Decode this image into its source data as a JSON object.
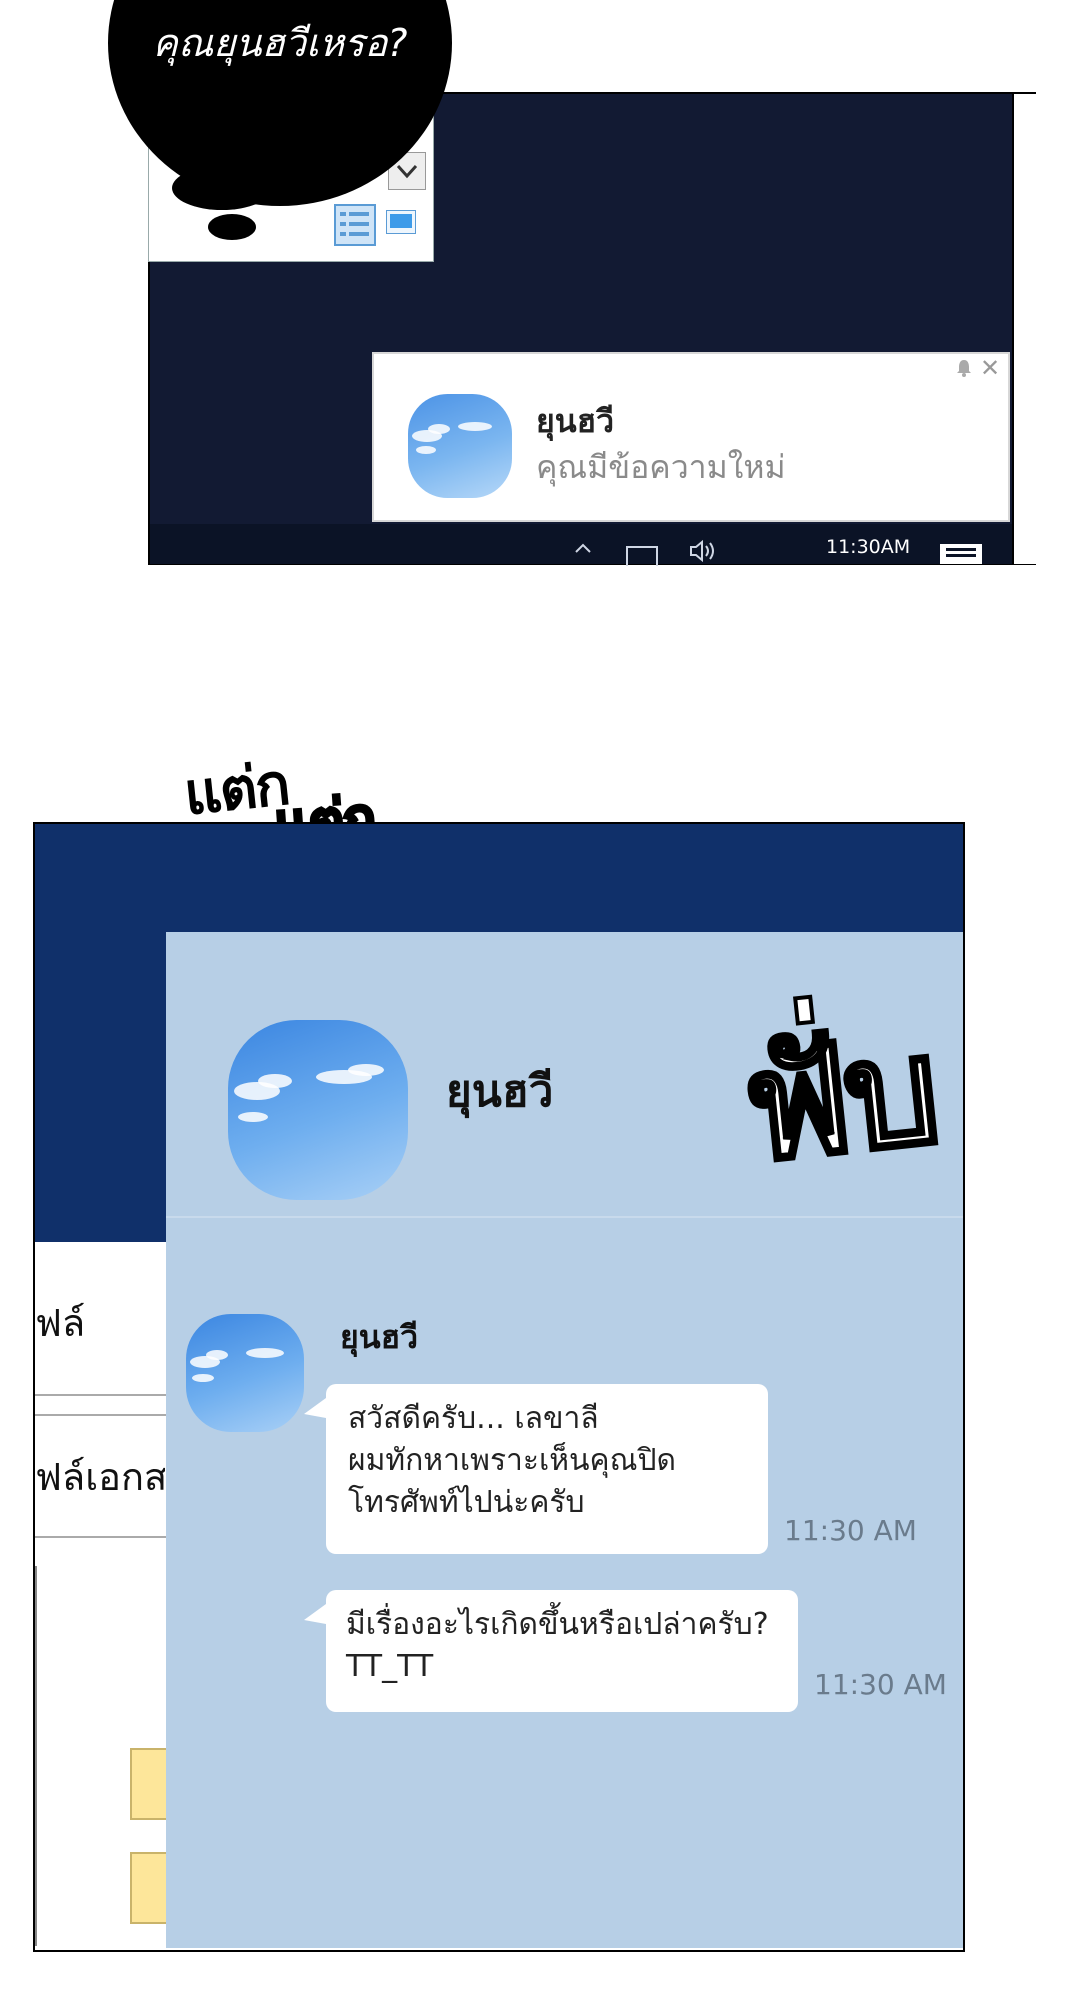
{
  "top_panel": {
    "speech_bubble": "คุณยุนฮวีเหรอ?",
    "notification": {
      "sender": "ยุนฮวี",
      "message": "คุณมีข้อความใหม่",
      "close_glyph": "✕",
      "bell_glyph": "🔔"
    },
    "taskbar": {
      "time": "11:30AM"
    }
  },
  "sfx": {
    "taek_1": "แต่ก",
    "taek_2": "แต่ก",
    "fup": "ฟั่บ"
  },
  "bottom_panel": {
    "background_rows": [
      "ฟล์",
      "ฟล์เอกสาร"
    ],
    "chat": {
      "header_name": "ยุนฮวี",
      "sender": "ยุนฮวี",
      "messages": [
        {
          "text": "สวัสดีครับ... เลขาลี\nผมทักหาเพราะเห็นคุณปิด\nโทรศัพท์ไปน่ะครับ",
          "time": "11:30 AM"
        },
        {
          "text": "มีเรื่องอะไรเกิดขึ้นหรือเปล่าครับ?\nTT_TT",
          "time": "11:30 AM"
        }
      ]
    }
  },
  "colors": {
    "desktop_bg": "#121a33",
    "chat_bg": "#b7cfe6",
    "header_bg": "#10306a"
  }
}
